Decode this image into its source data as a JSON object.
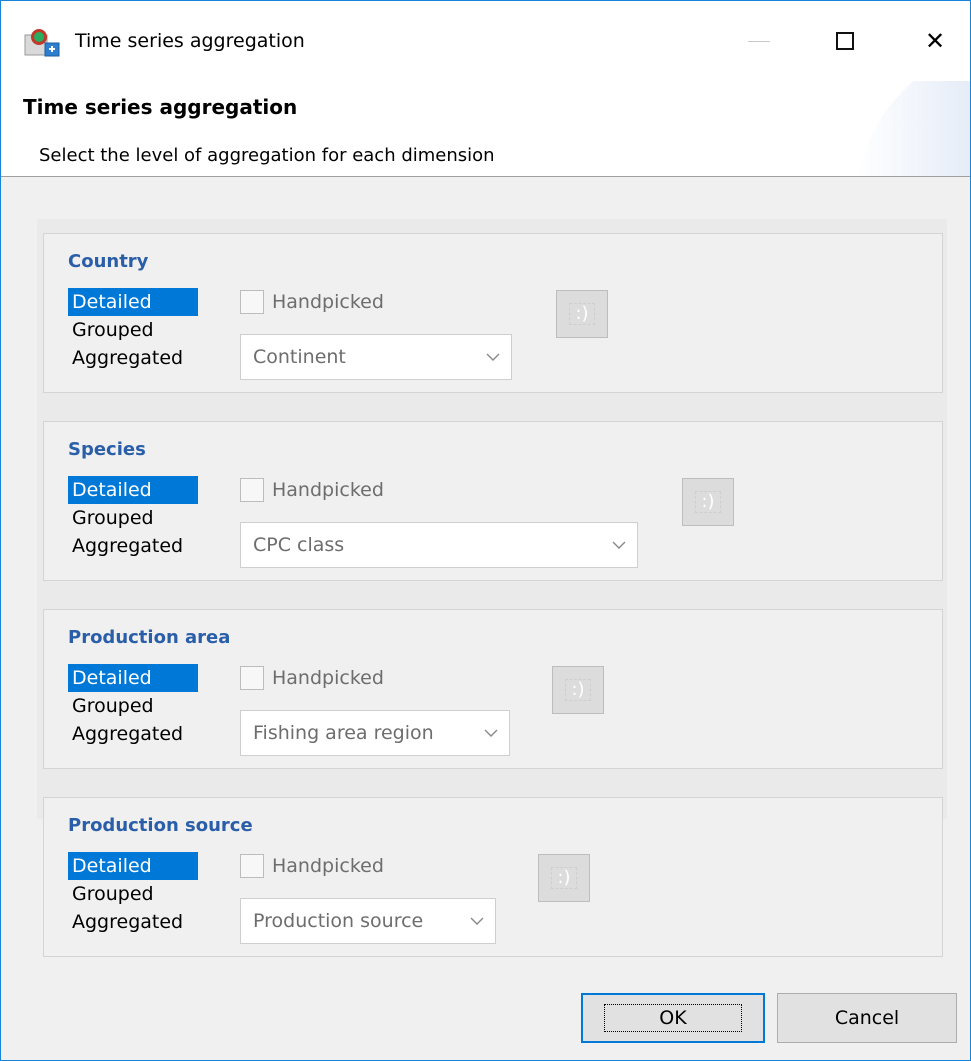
{
  "window": {
    "title": "Time series aggregation",
    "icons": {
      "app": "app-icon",
      "minimize": "minimize-icon",
      "maximize": "maximize-icon",
      "close": "close-icon"
    },
    "close_glyph": "✕"
  },
  "header": {
    "title": "Time series aggregation",
    "subtitle": "Select the level of aggregation for each dimension"
  },
  "dimensions": [
    {
      "title": "Country",
      "levels": [
        "Detailed",
        "Grouped",
        "Aggregated"
      ],
      "selected": "Detailed",
      "handpicked_label": "Handpicked",
      "handpicked_checked": false,
      "combo_value": "Continent",
      "pick_icon": "pick-icon"
    },
    {
      "title": "Species",
      "levels": [
        "Detailed",
        "Grouped",
        "Aggregated"
      ],
      "selected": "Detailed",
      "handpicked_label": "Handpicked",
      "handpicked_checked": false,
      "combo_value": "CPC class",
      "pick_icon": "pick-icon"
    },
    {
      "title": "Production area",
      "levels": [
        "Detailed",
        "Grouped",
        "Aggregated"
      ],
      "selected": "Detailed",
      "handpicked_label": "Handpicked",
      "handpicked_checked": false,
      "combo_value": "Fishing area region",
      "pick_icon": "pick-icon"
    },
    {
      "title": "Production source",
      "levels": [
        "Detailed",
        "Grouped",
        "Aggregated"
      ],
      "selected": "Detailed",
      "handpicked_label": "Handpicked",
      "handpicked_checked": false,
      "combo_value": "Production source",
      "pick_icon": "pick-icon"
    }
  ],
  "pick_glyph": ":)",
  "buttons": {
    "ok": "OK",
    "cancel": "Cancel"
  },
  "colors": {
    "accent": "#0078d7",
    "group_title": "#2a5ea8",
    "window_border": "#1883d7"
  }
}
